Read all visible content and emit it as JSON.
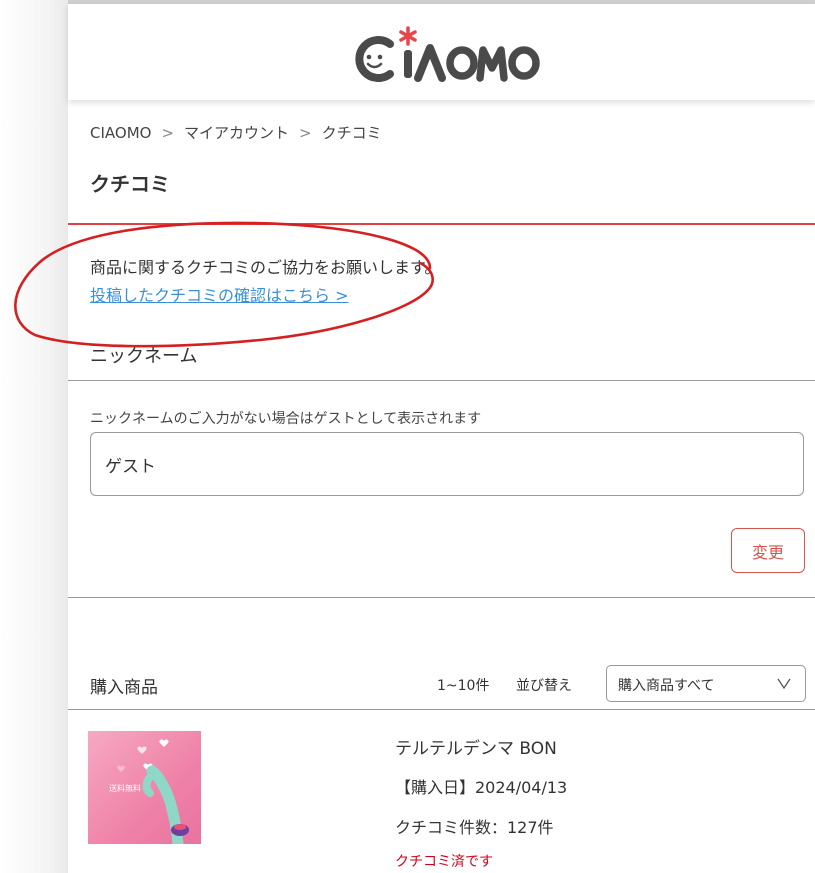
{
  "brand": {
    "logo_text": "CIAOMO",
    "colors": {
      "accent_red": "#e3413f",
      "link_blue": "#3a8fd8",
      "logo_gray": "#4a4a4a",
      "logo_star": "#e8454b"
    }
  },
  "breadcrumb": {
    "items": [
      "CIAOMO",
      "マイアカウント",
      "クチコミ"
    ],
    "separator": ">"
  },
  "page": {
    "title": "クチコミ"
  },
  "intro": {
    "text": "商品に関するクチコミのご協力をお願いします。",
    "link": "投稿したクチコミの確認はこちら >"
  },
  "nickname": {
    "section_title": "ニックネーム",
    "help": "ニックネームのご入力がない場合はゲストとして表示されます",
    "value": "ゲスト",
    "button": "変更"
  },
  "purchases": {
    "title": "購入商品",
    "count": "1~10件",
    "sort_label": "並び替え",
    "sort_value": "購入商品すべて",
    "items": [
      {
        "name": "テルテルデンマ BON",
        "date": "【購入日】2024/04/13",
        "reviews": "クチコミ件数：127件",
        "status": "クチコミ済です",
        "image_text": "送料無料"
      }
    ]
  }
}
